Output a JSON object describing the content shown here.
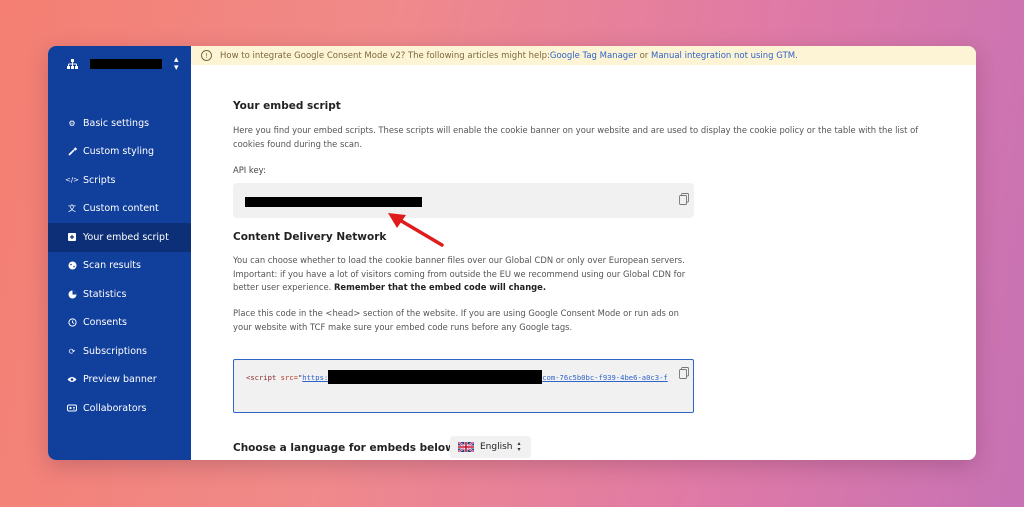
{
  "banner": {
    "text_before": "How to integrate Google Consent Mode v2? The following articles might help: ",
    "link1": "Google Tag Manager",
    "middle": " or ",
    "link2": "Manual integration not using GTM."
  },
  "sidebar": {
    "items": [
      {
        "label": "Basic settings",
        "icon": "gear-icon"
      },
      {
        "label": "Custom styling",
        "icon": "brush-icon"
      },
      {
        "label": "Scripts",
        "icon": "code-icon"
      },
      {
        "label": "Custom content",
        "icon": "translate-icon"
      },
      {
        "label": "Your embed script",
        "icon": "embed-icon",
        "active": true
      },
      {
        "label": "Scan results",
        "icon": "scan-icon"
      },
      {
        "label": "Statistics",
        "icon": "pie-chart-icon"
      },
      {
        "label": "Consents",
        "icon": "history-icon"
      },
      {
        "label": "Subscriptions",
        "icon": "refresh-icon"
      },
      {
        "label": "Preview banner",
        "icon": "eye-icon"
      },
      {
        "label": "Collaborators",
        "icon": "users-icon"
      }
    ]
  },
  "main": {
    "embed_title": "Your embed script",
    "embed_desc": "Here you find your embed scripts. These scripts will enable the cookie banner on your website and are used to display the cookie policy or the table with the list of cookies found during the scan.",
    "api_key_label": "API key:",
    "cdn_title": "Content Delivery Network",
    "cdn_desc_1": "You can choose whether to load the cookie banner files over our Global CDN or only over European servers. Important: if you have a lot of visitors coming from outside the EU we recommend using our Global CDN for better user experience. ",
    "cdn_desc_bold": "Remember that the embed code will change.",
    "place_desc": "Place this code in the <head> section of the website. If you are using Google Consent Mode or run ads on your website with TCF make sure your embed code runs before any Google tags.",
    "code": {
      "open": "<script",
      "attr": " src=",
      "quote": "\"",
      "url_start": "https:",
      "url_end": "com-76c5b0bc-f939-4be6-a0c3-f"
    },
    "language_label": "Choose a language for embeds below:",
    "language_value": "English"
  }
}
